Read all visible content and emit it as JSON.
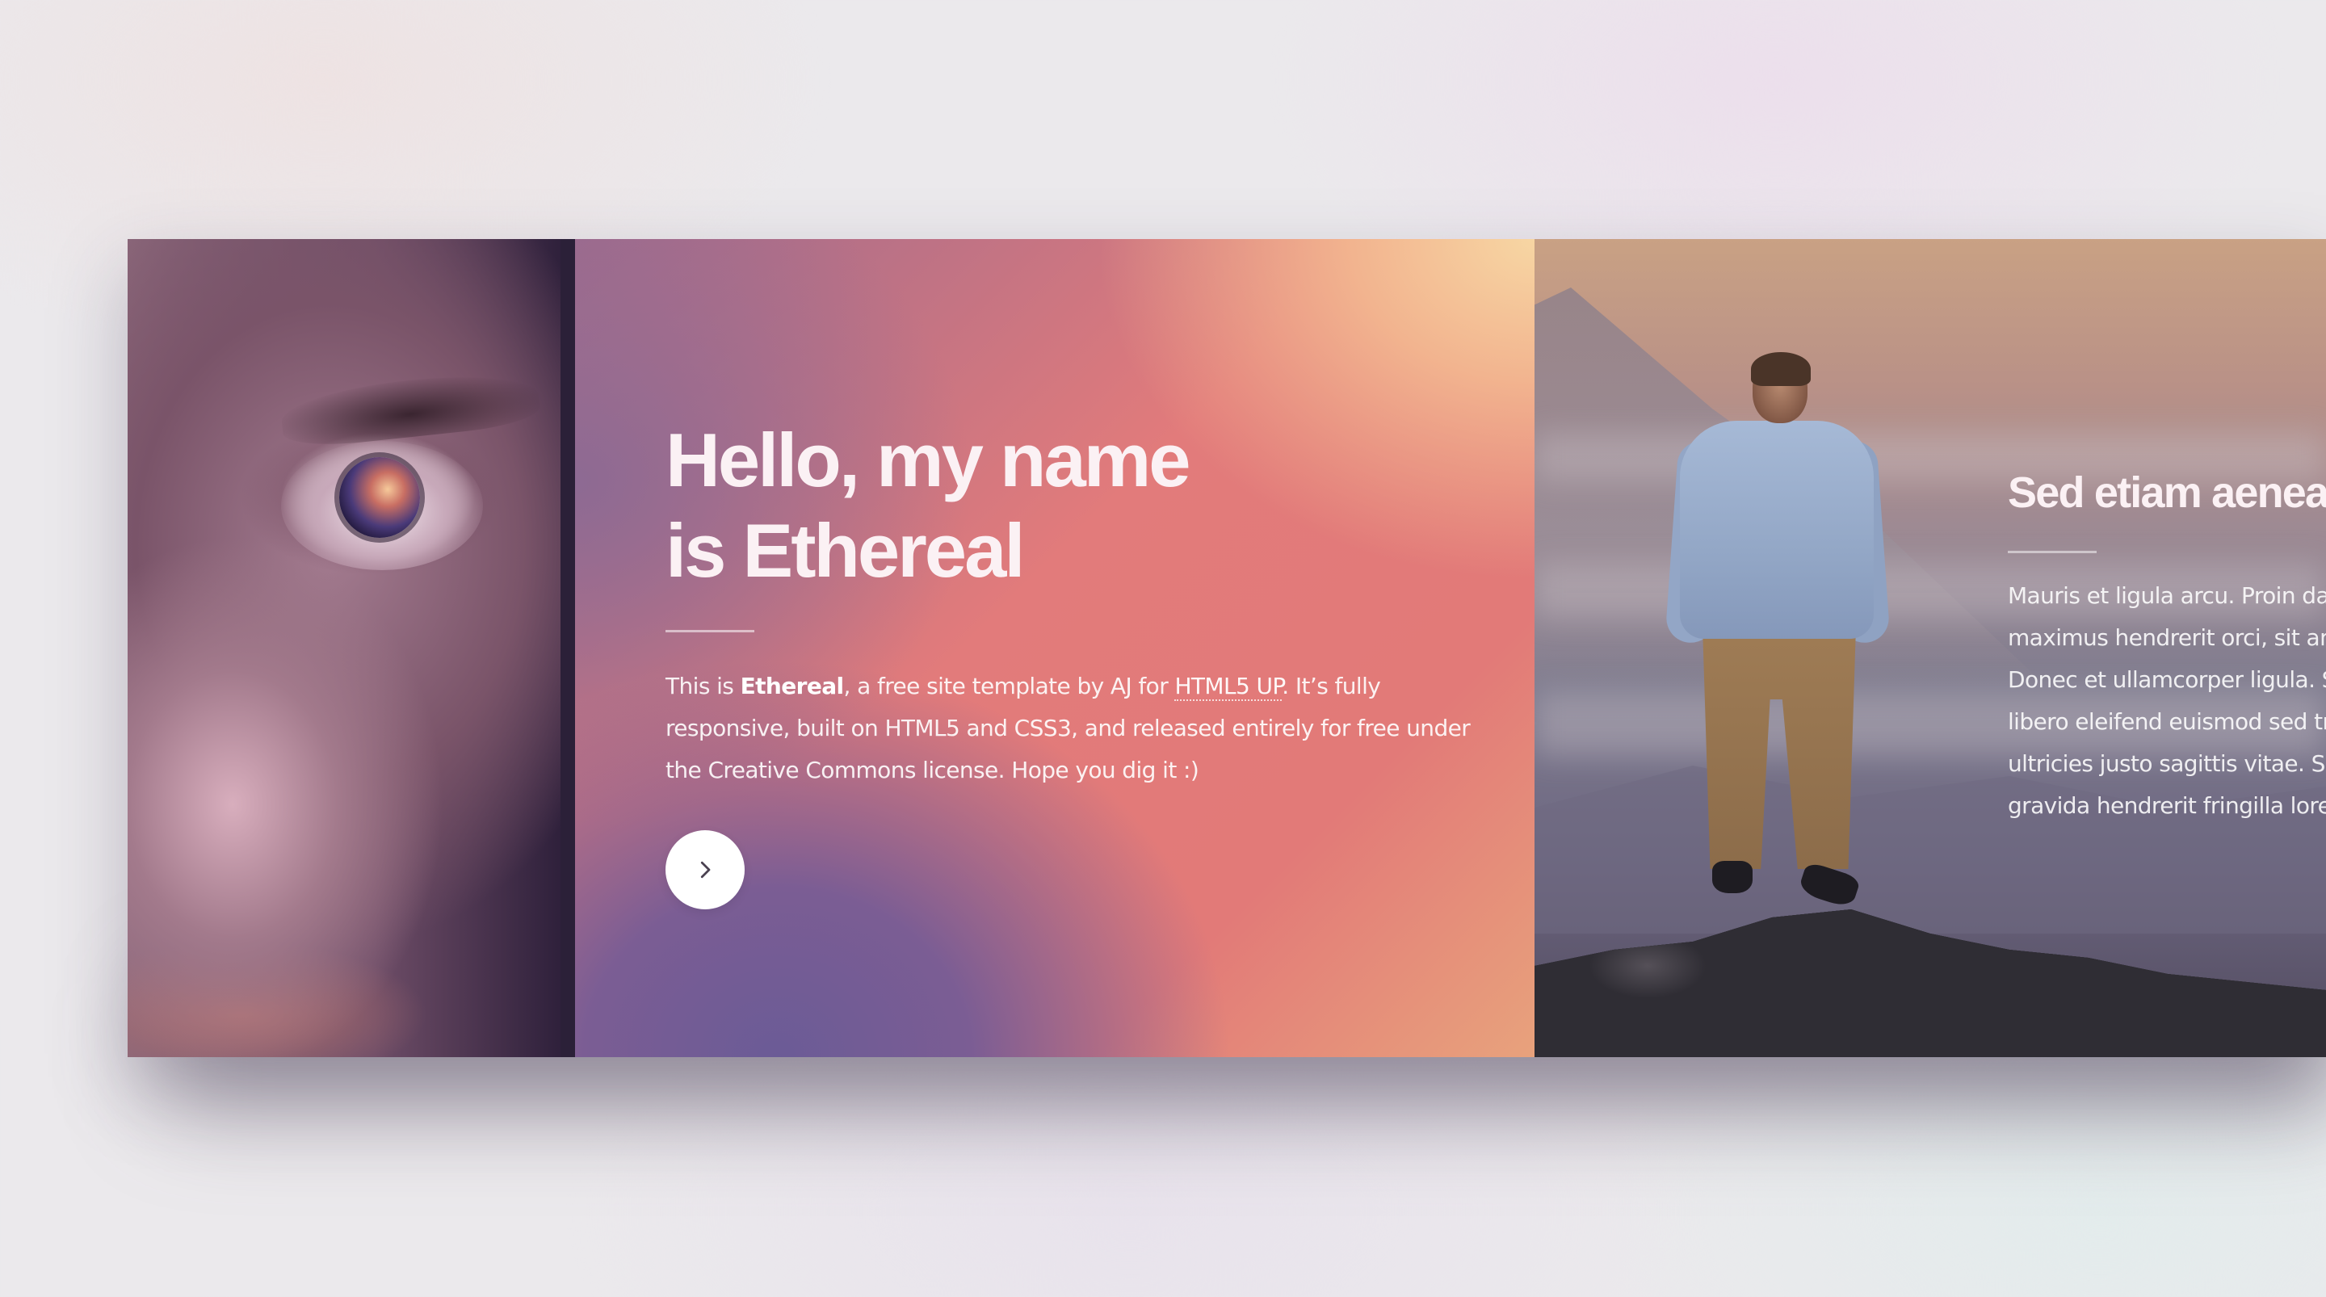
{
  "intro": {
    "title_line1": "Hello, my name",
    "title_line2": "is Ethereal",
    "text_part1": "This is ",
    "text_bold": "Ethereal",
    "text_part2": ", a free site template by AJ for ",
    "text_link": "HTML5 UP",
    "text_part3": ". It’s fully responsive, built on HTML5 and CSS3, and released entirely for free under the Creative Commons license. Hope you dig it :)",
    "next_button_icon": "chevron-right-icon"
  },
  "panel_two": {
    "title": "Sed etiam aenea",
    "lines": [
      "Mauris et ligula arcu. Proin dap",
      "maximus hendrerit orci, sit ame",
      "Donec et ullamcorper ligula. Su",
      "libero eleifend euismod sed tris",
      "ultricies justo sagittis vitae. Sec",
      "gravida hendrerit fringilla lorem"
    ]
  },
  "colors": {
    "gradient_warm": "#f7d6a3",
    "gradient_coral": "#e27b7b",
    "gradient_purple": "#6b5b96",
    "text_light": "#fbf1f4"
  }
}
